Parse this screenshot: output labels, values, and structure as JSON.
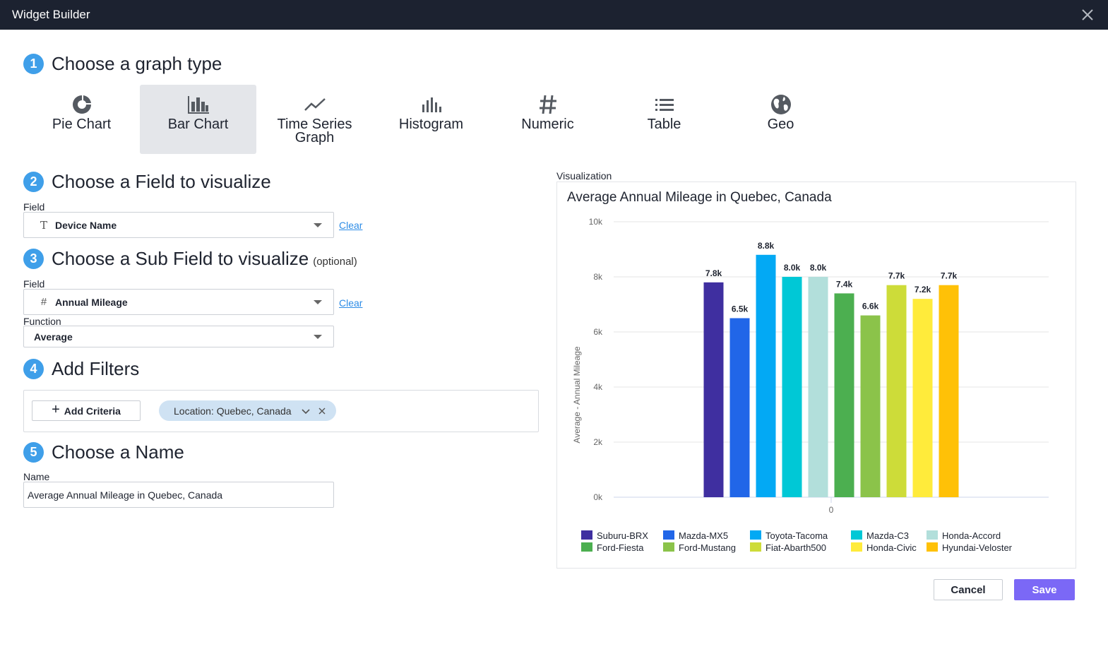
{
  "window": {
    "title": "Widget Builder",
    "close_icon": "close-icon"
  },
  "steps": {
    "s1": {
      "num": "1",
      "label": "Choose a graph type"
    },
    "s2": {
      "num": "2",
      "label": "Choose a Field to visualize"
    },
    "s3": {
      "num": "3",
      "label": "Choose a Sub Field to visualize",
      "optional": "(optional)"
    },
    "s4": {
      "num": "4",
      "label": "Add Filters"
    },
    "s5": {
      "num": "5",
      "label": "Choose a Name"
    }
  },
  "graph_types": [
    {
      "label": "Pie Chart",
      "icon": "pie-chart-icon",
      "selected": false
    },
    {
      "label": "Bar Chart",
      "icon": "bar-chart-icon",
      "selected": true
    },
    {
      "label": "Time Series Graph",
      "icon": "line-chart-icon",
      "selected": false
    },
    {
      "label": "Histogram",
      "icon": "histogram-icon",
      "selected": false
    },
    {
      "label": "Numeric",
      "icon": "hash-icon",
      "selected": false
    },
    {
      "label": "Table",
      "icon": "list-icon",
      "selected": false
    },
    {
      "label": "Geo",
      "icon": "globe-icon",
      "selected": false
    }
  ],
  "field": {
    "label": "Field",
    "type_icon": "T",
    "value": "Device Name",
    "clear": "Clear"
  },
  "subfield": {
    "label": "Field",
    "type_icon": "#",
    "value": "Annual Mileage",
    "clear": "Clear"
  },
  "function": {
    "label": "Function",
    "value": "Average"
  },
  "filters": {
    "add_label": "Add Criteria",
    "chips": [
      {
        "label": "Location: Quebec, Canada"
      }
    ]
  },
  "name": {
    "label": "Name",
    "value": "Average Annual Mileage in Quebec, Canada"
  },
  "visualization": {
    "label": "Visualization"
  },
  "chart_data": {
    "type": "bar",
    "title": "Average Annual Mileage in Quebec, Canada",
    "xlabel": "",
    "ylabel": "Average - Annual Mileage",
    "ylim": [
      0,
      10000
    ],
    "yticks": [
      0,
      2000,
      4000,
      6000,
      8000,
      10000
    ],
    "ytick_labels": [
      "0k",
      "2k",
      "4k",
      "6k",
      "8k",
      "10k"
    ],
    "categories": [
      "0"
    ],
    "grid": true,
    "legend": "bottom",
    "series": [
      {
        "name": "Suburu-BRX",
        "values": [
          7800
        ],
        "label": "7.8k",
        "color": "#3f2fa0"
      },
      {
        "name": "Mazda-MX5",
        "values": [
          6500
        ],
        "label": "6.5k",
        "color": "#2166e8"
      },
      {
        "name": "Toyota-Tacoma",
        "values": [
          8800
        ],
        "label": "8.8k",
        "color": "#03a9f4"
      },
      {
        "name": "Mazda-C3",
        "values": [
          8000
        ],
        "label": "8.0k",
        "color": "#00c8d6"
      },
      {
        "name": "Honda-Accord",
        "values": [
          8000
        ],
        "label": "8.0k",
        "color": "#b2dfdb"
      },
      {
        "name": "Ford-Fiesta",
        "values": [
          7400
        ],
        "label": "7.4k",
        "color": "#4caf50"
      },
      {
        "name": "Ford-Mustang",
        "values": [
          6600
        ],
        "label": "6.6k",
        "color": "#8bc34a"
      },
      {
        "name": "Fiat-Abarth500",
        "values": [
          7700
        ],
        "label": "7.7k",
        "color": "#cddc39"
      },
      {
        "name": "Honda-Civic",
        "values": [
          7200
        ],
        "label": "7.2k",
        "color": "#ffeb3b"
      },
      {
        "name": "Hyundai-Veloster",
        "values": [
          7700
        ],
        "label": "7.7k",
        "color": "#ffc107"
      }
    ]
  },
  "actions": {
    "cancel": "Cancel",
    "save": "Save"
  },
  "colors": {
    "accent": "#3f9fe9",
    "save": "#7b68f6",
    "titlebar": "#1c2230",
    "link": "#2d8ce6",
    "chip": "#cfe2f3"
  }
}
